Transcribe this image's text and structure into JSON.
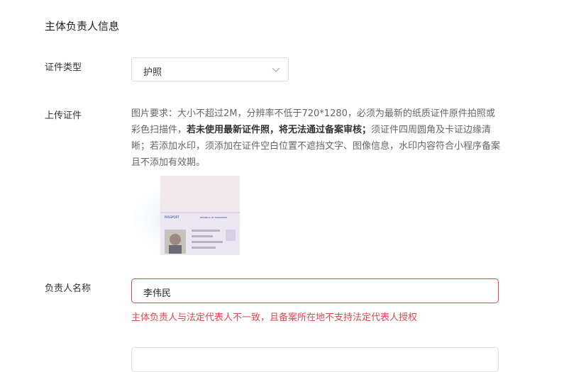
{
  "section": {
    "title": "主体负责人信息"
  },
  "id_type": {
    "label": "证件类型",
    "value": "护照"
  },
  "upload": {
    "label": "上传证件",
    "req_part1": "图片要求：大小不超过2M，分辨率不低于720*1280，必须为最新的纸质证件原件拍照或彩色扫描件，",
    "req_bold": "若未使用最新证件照，将无法通过备案审核；",
    "req_part2": "须证件四周圆角及卡证边缘清晰；若添加水印，须添加在证件空白位置不遮挡文字、图像信息，水印内容符合小程序备案且不添加有效期。",
    "passport_header": "PASSPORT",
    "passport_country": "REPUBLIC OF SINGAPORE"
  },
  "responsible_name": {
    "label": "负责人名称",
    "value": "李伟民",
    "error": "主体负责人与法定代表人不一致，且备案所在地不支持法定代表人授权"
  },
  "colors": {
    "error": "#e0474f",
    "border": "#dcdcdc"
  }
}
